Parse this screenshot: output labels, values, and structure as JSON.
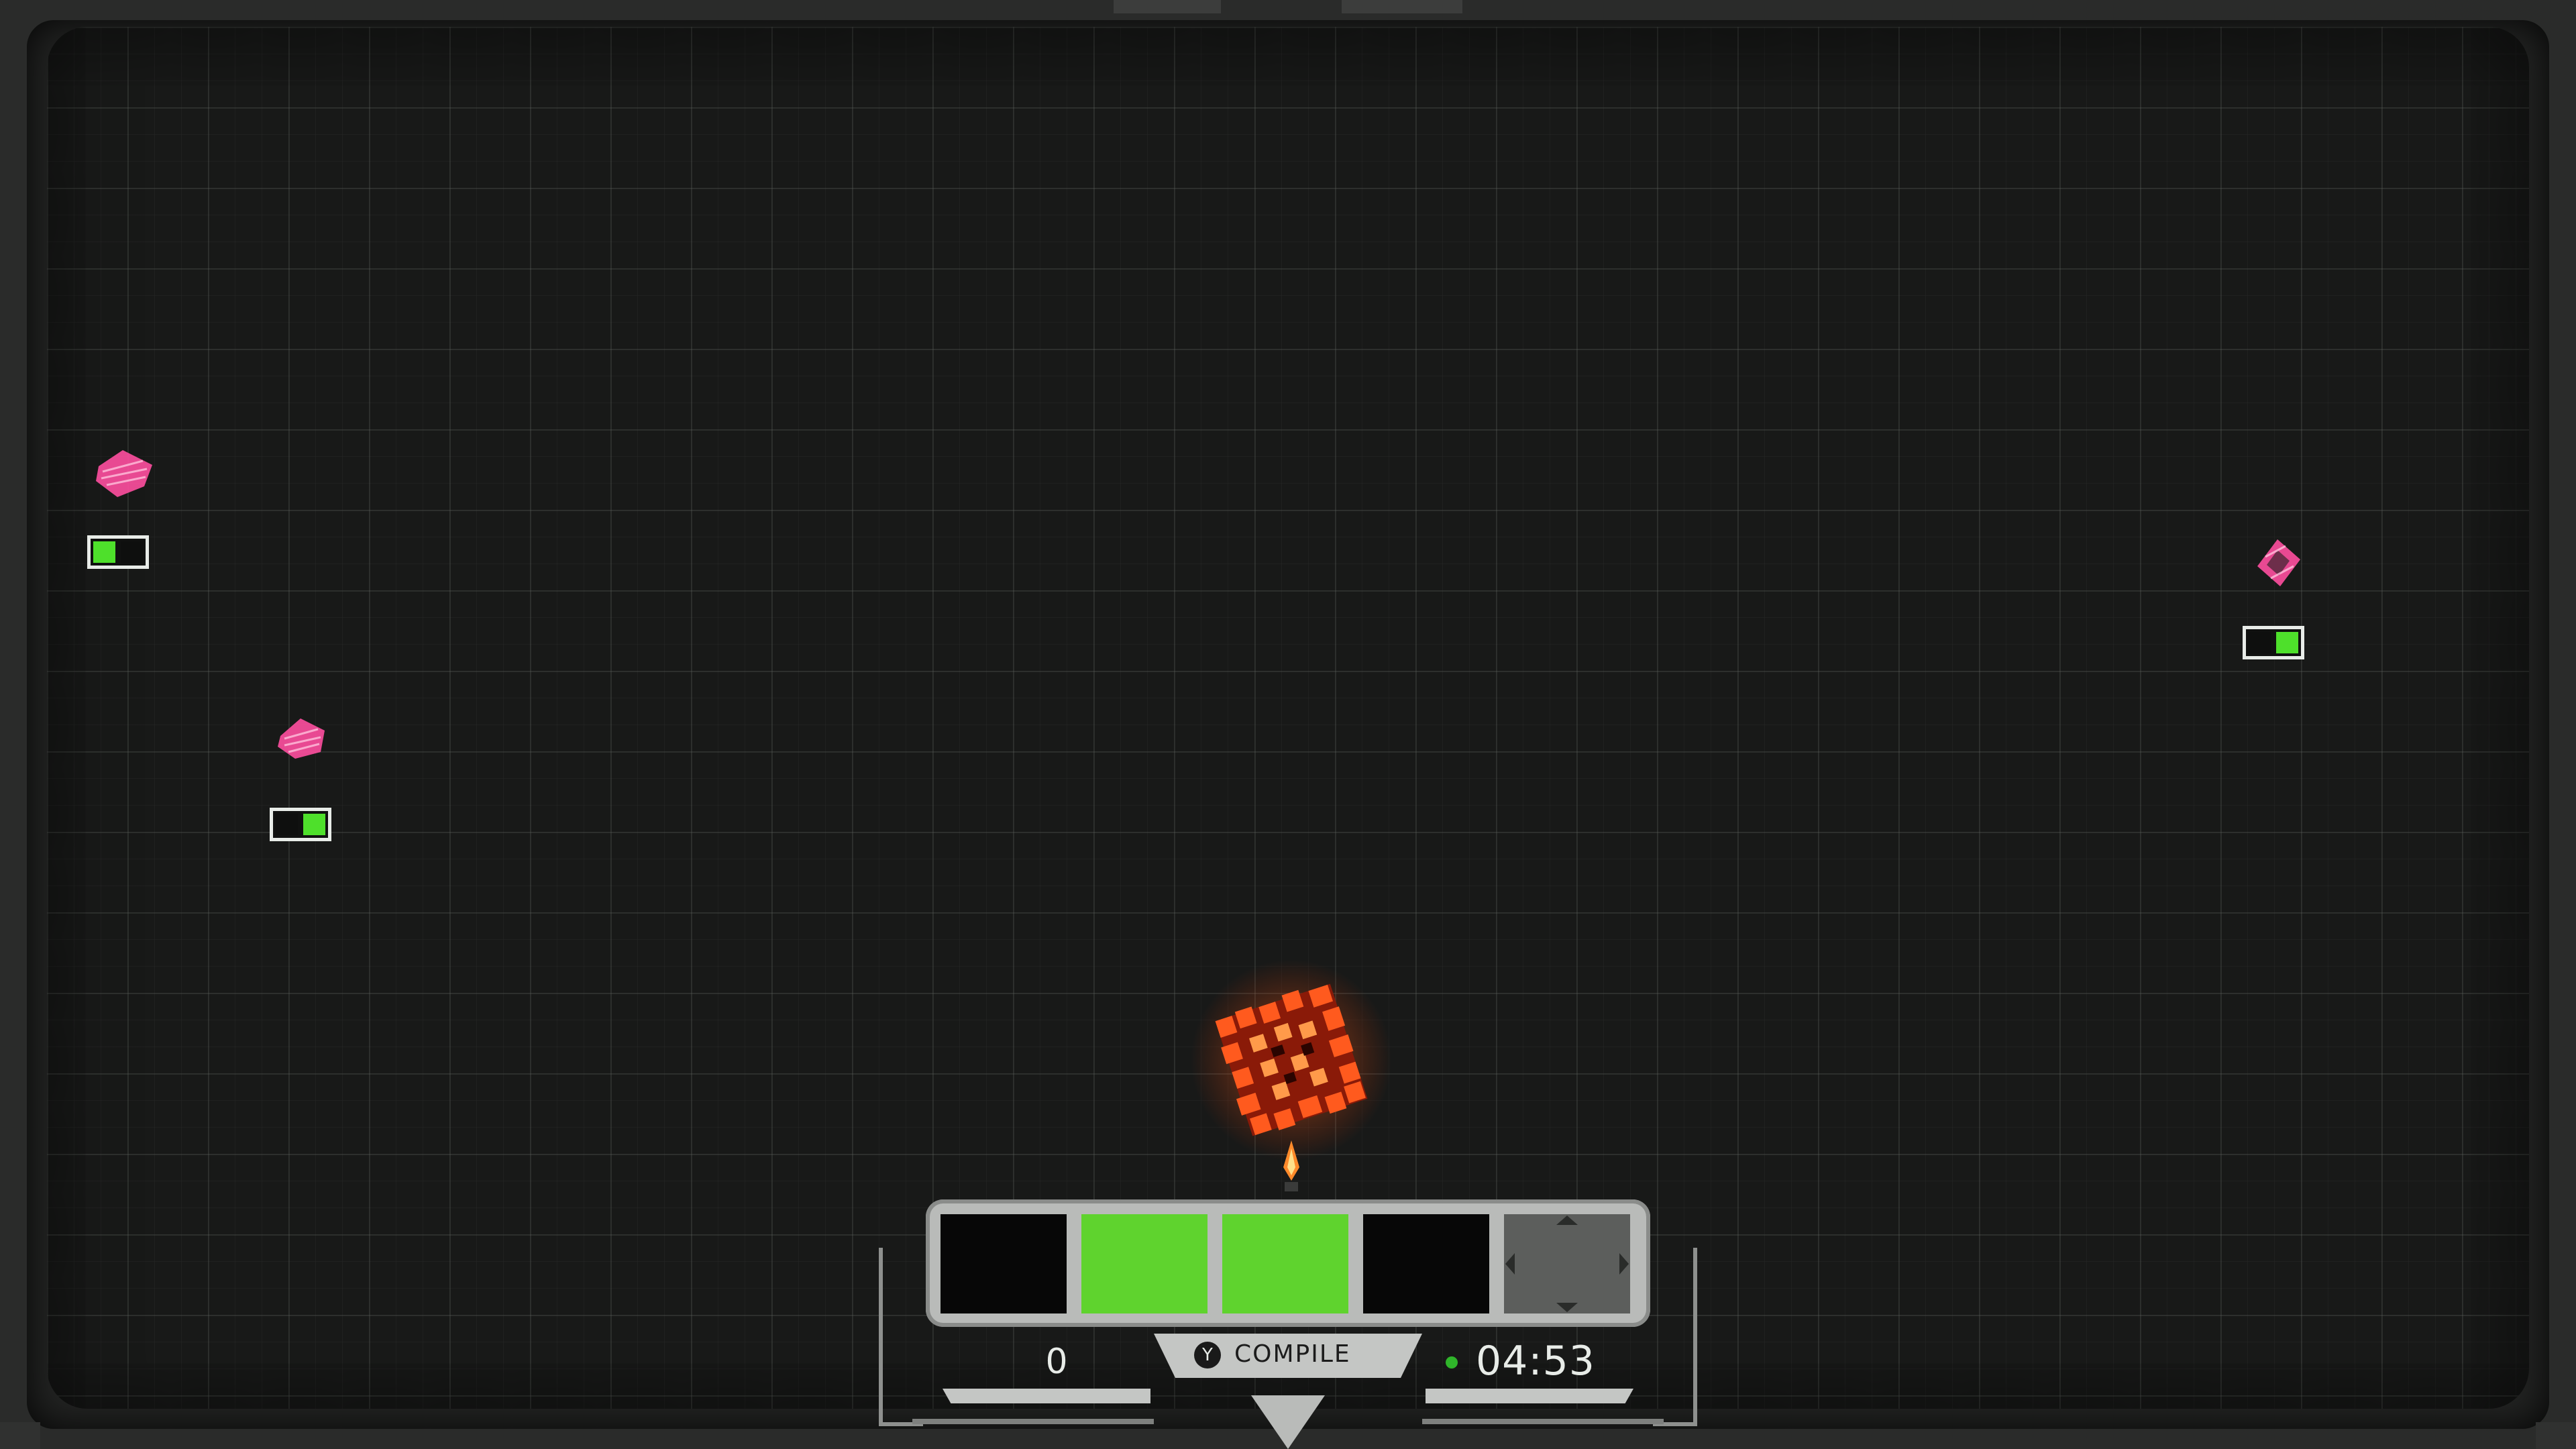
{
  "hud": {
    "score": "0",
    "compile_button_glyph": "Y",
    "compile_label": "COMPILE",
    "timer": "04:53",
    "slots": [
      {
        "state": "empty"
      },
      {
        "state": "filled"
      },
      {
        "state": "filled"
      },
      {
        "state": "empty"
      },
      {
        "state": "dpad",
        "icon": "dpad-icon"
      }
    ]
  },
  "enemies": [
    {
      "name": "enemy-1",
      "health_filled": 1,
      "health_total": 2
    },
    {
      "name": "enemy-2",
      "health_filled": 1,
      "health_total": 2
    },
    {
      "name": "enemy-3",
      "health_filled": 1,
      "health_total": 2
    }
  ],
  "colors": {
    "health_on": "#4ee02b",
    "slot_filled": "#5fd32e",
    "enemy": "#ff4fa0",
    "player": "#ff5a1e",
    "timer_dot": "#2fb52a"
  },
  "icons": [
    "player-cube-icon",
    "enemy-shard-icon",
    "dpad-icon",
    "y-button-icon",
    "status-dot-icon"
  ]
}
